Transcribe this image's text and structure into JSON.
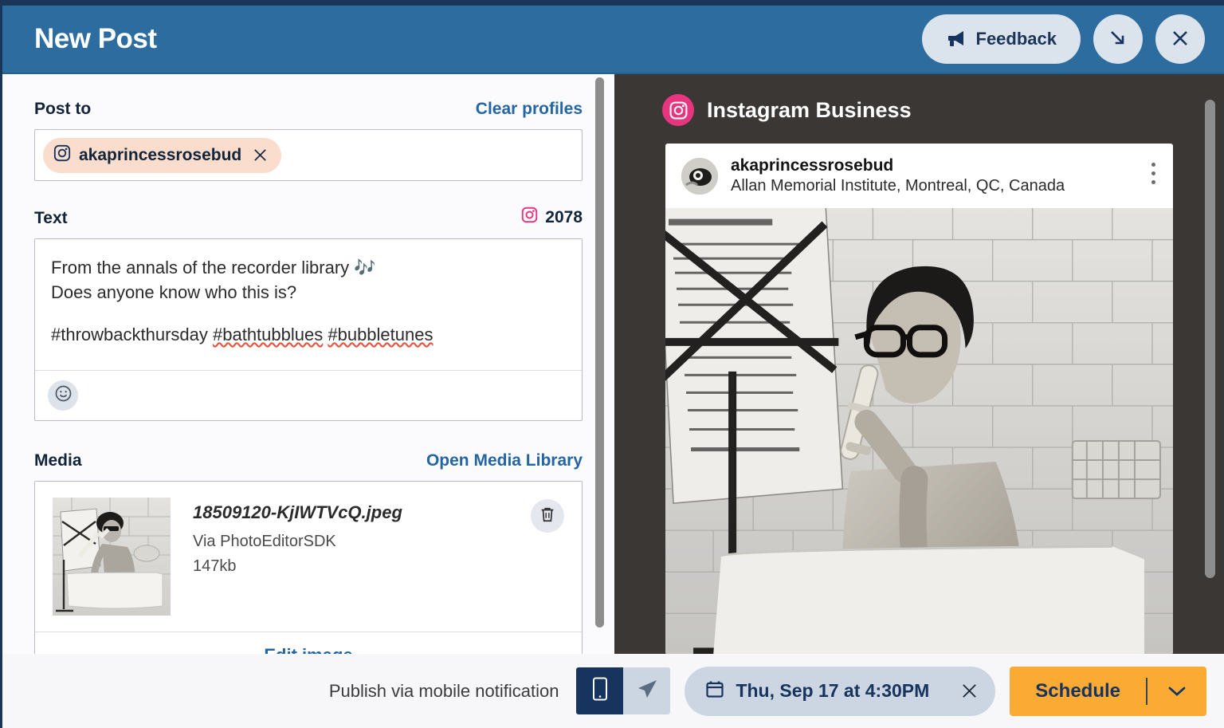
{
  "header": {
    "title": "New Post",
    "feedback_label": "Feedback",
    "minimize_icon": "arrow-down-right-icon",
    "close_icon": "close-icon",
    "bar_color": "#2d6c9f"
  },
  "composer": {
    "post_to": {
      "label": "Post to",
      "clear_label": "Clear profiles",
      "profiles": [
        {
          "name": "akaprincessrosebud",
          "network": "instagram",
          "chip_color": "#fbddcd"
        }
      ]
    },
    "text": {
      "label": "Text",
      "counter": "2078",
      "counter_network": "instagram",
      "lines": [
        "From the annals of the recorder library 🎶",
        "Does anyone know who this is?"
      ],
      "hashtag_line_prefix": "#throwbackthursday ",
      "hashtag_1": "#bathtubblues",
      "hashtag_sep": " ",
      "hashtag_2": "#bubbletunes",
      "emoji_button_icon": "emoji-smiley-icon"
    },
    "media": {
      "label": "Media",
      "open_library_label": "Open Media Library",
      "file_name": "18509120-KjIWTVcQ.jpeg",
      "file_source": "Via PhotoEditorSDK",
      "file_size": "147kb",
      "delete_icon": "trash-icon",
      "edit_label": "Edit image"
    }
  },
  "preview": {
    "network_label": "Instagram Business",
    "network_color": "#e8357f",
    "panel_color": "#3b3735",
    "post": {
      "username": "akaprincessrosebud",
      "location": "Allan Memorial Institute, Montreal, QC, Canada",
      "menu_icon": "more-vertical-icon"
    }
  },
  "footer": {
    "publish_note": "Publish via mobile notification",
    "mode_options": [
      {
        "icon": "mobile-phone-icon",
        "active": true
      },
      {
        "icon": "paper-plane-icon",
        "active": false
      }
    ],
    "schedule_date": "Thu, Sep 17 at 4:30PM",
    "date_icon": "calendar-icon",
    "date_clear_icon": "close-icon",
    "schedule_label": "Schedule",
    "schedule_caret_icon": "chevron-down-icon",
    "schedule_color": "#fbaa33"
  }
}
